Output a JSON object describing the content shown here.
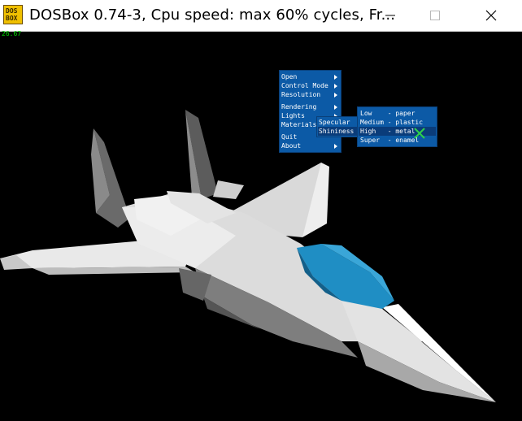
{
  "window": {
    "icon_line1": "DOS",
    "icon_line2": "BOX",
    "title": "DOSBox 0.74-3, Cpu speed: max  60% cycles, Fr..."
  },
  "fps_counter": "26.67",
  "menus": {
    "main": [
      "Open",
      "Control Mode",
      "Resolution",
      "Rendering",
      "Lights",
      "Materials",
      "Quit",
      "About"
    ],
    "materials": [
      "Specular",
      "Shininess"
    ],
    "shininess": [
      "Low    - paper",
      "Medium - plastic",
      "High   - metal",
      "Super  - enamel"
    ]
  },
  "colors": {
    "menu_bg": "#0c5aa6",
    "menu_highlight": "#0a3c7a",
    "cockpit": "#1f8ec4",
    "checkmark": "#2ed14a"
  }
}
